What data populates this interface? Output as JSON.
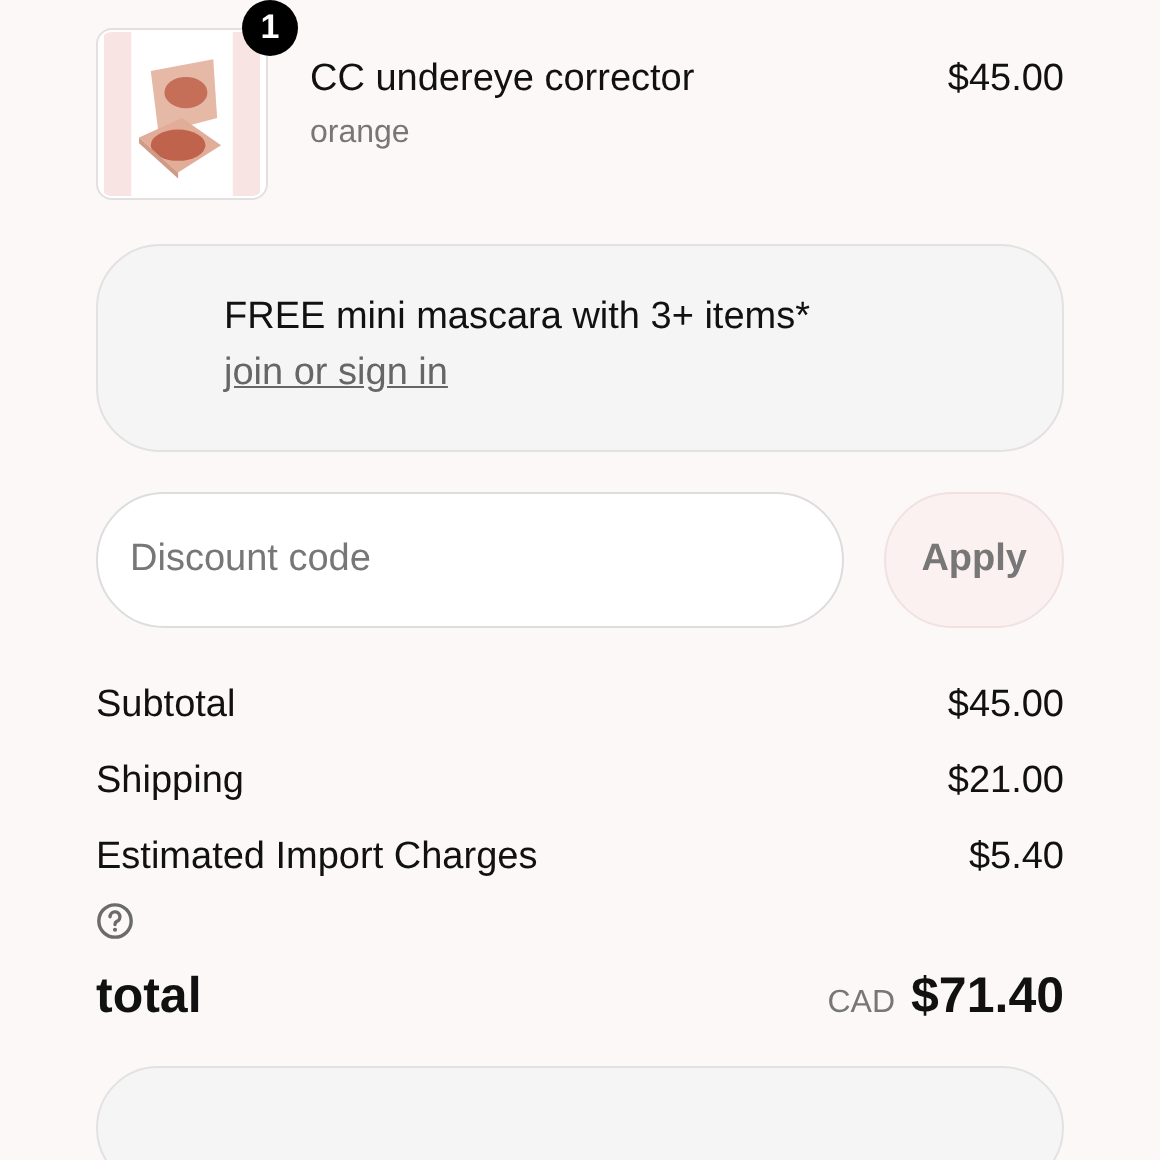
{
  "cart_item": {
    "name": "CC undereye corrector",
    "variant": "orange",
    "price": "$45.00",
    "quantity_badge": "1"
  },
  "promo": {
    "text": "FREE mini mascara with 3+ items*",
    "link": "join or sign in"
  },
  "discount": {
    "placeholder": "Discount code",
    "button": "Apply"
  },
  "summary": [
    {
      "label": "Subtotal",
      "value": "$45.00"
    },
    {
      "label": "Shipping",
      "value": "$21.00"
    },
    {
      "label": "Estimated Import Charges",
      "value": "$5.40",
      "help": true
    }
  ],
  "total": {
    "label": "total",
    "currency": "CAD",
    "amount": "$71.40"
  }
}
